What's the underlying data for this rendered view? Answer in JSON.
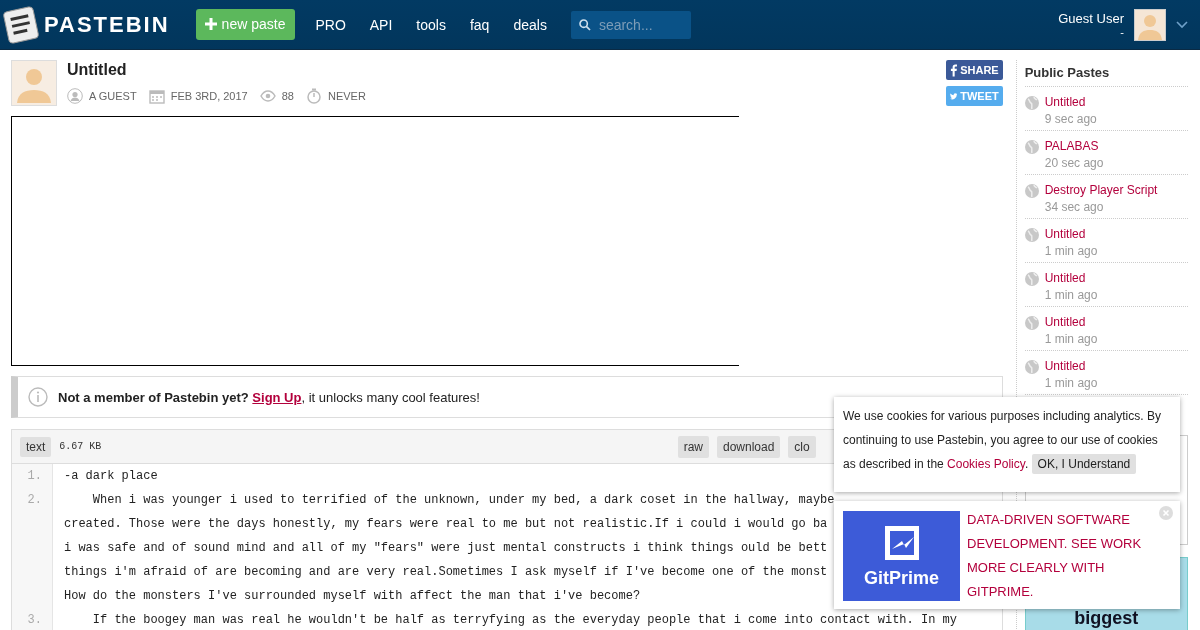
{
  "header": {
    "logo_text": "PASTEBIN",
    "new_paste": "new paste",
    "nav": [
      "PRO",
      "API",
      "tools",
      "faq",
      "deals"
    ],
    "search": {
      "placeholder": "search..."
    },
    "user": {
      "name": "Guest User",
      "sub": "-"
    }
  },
  "paste": {
    "title": "Untitled",
    "meta": [
      {
        "kind": "user",
        "text": "A GUEST"
      },
      {
        "kind": "date",
        "text": "FEB 3RD, 2017"
      },
      {
        "kind": "views",
        "text": "88"
      },
      {
        "kind": "expire",
        "text": "NEVER"
      }
    ],
    "share": [
      {
        "kind": "facebook",
        "label": "SHARE"
      },
      {
        "kind": "twitter",
        "label": "TWEET"
      }
    ]
  },
  "notice": {
    "text": "Not a member of Pastebin yet?",
    "link": "Sign Up",
    "rest": ", it unlocks many cool features!"
  },
  "code": {
    "syntax": "text",
    "size": "6.67 KB",
    "actions": [
      "raw",
      "download",
      "clo"
    ],
    "lines": [
      {
        "number": "1.",
        "text": [
          "-a dark place"
        ]
      },
      {
        "number": "2.",
        "text": [
          "    When i was younger i used to terrified of the unknown, under my bed, a dark coset in the hallway, maybe",
          "created. Those were the days honestly, my fears were real to me but not realistic.If i could i would go ba",
          "i was safe and of sound mind and all of my \"fears\" were just mental constructs i think things ould be bett",
          "things i'm afraid of are becoming and are very real.Sometimes I ask myself if I've become one of the monst",
          "How do the monsters I've surrounded myself with affect the man that i've become?"
        ]
      },
      {
        "number": "3.",
        "text": [
          "    If the boogey man was real he wouldn't be half as terryfying as the everyday people that i come into contact with. In my"
        ]
      }
    ]
  },
  "sidebar": {
    "title": "Public Pastes",
    "items": [
      {
        "title": "Untitled",
        "time": "9 sec ago"
      },
      {
        "title": "PALABAS",
        "time": "20 sec ago"
      },
      {
        "title": "Destroy Player Script",
        "time": "34 sec ago"
      },
      {
        "title": "Untitled",
        "time": "1 min ago"
      },
      {
        "title": "Untitled",
        "time": "1 min ago"
      },
      {
        "title": "Untitled",
        "time": "1 min ago"
      },
      {
        "title": "Untitled",
        "time": "1 min ago"
      }
    ],
    "ad_word": "biggest"
  },
  "cookie": {
    "text": "We use cookies for various purposes including analytics. By continuing to use Pastebin, you agree to our use of cookies as described in the",
    "link": "Cookies Policy",
    "after": ".",
    "button": "OK, I Understand"
  },
  "ad": {
    "brand": "GitPrime",
    "text": "DATA-DRIVEN SOFTWARE DEVELOPMENT. SEE WORK MORE CLEARLY WITH GITPRIME."
  }
}
